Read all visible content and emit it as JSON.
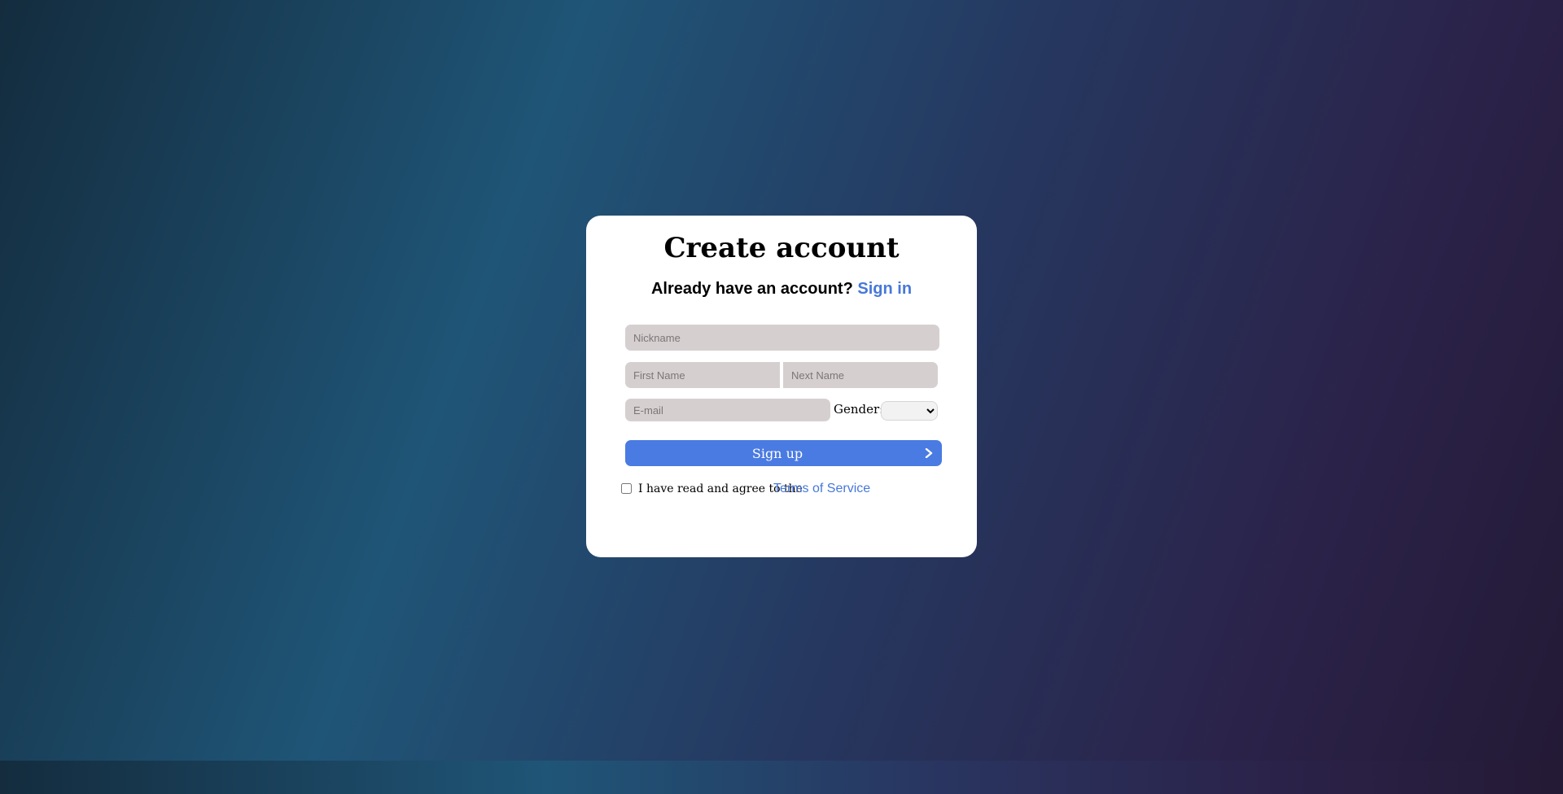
{
  "colors": {
    "accent": "#4a7be2",
    "link": "#4778d9",
    "field_bg": "#d6cfd0",
    "card_bg": "#ffffff"
  },
  "card": {
    "title": "Create account",
    "subtitle_text": "Already have an account?",
    "signin_link": "Sign in"
  },
  "form": {
    "nickname_placeholder": "Nickname",
    "firstname_placeholder": "First Name",
    "nextname_placeholder": "Next Name",
    "email_placeholder": "E-mail",
    "gender_label": "Gender:",
    "gender_selected": "",
    "signup_label": "Sign up",
    "signup_icon": "chevron-right-icon",
    "terms_text": "I have read and agree to the",
    "terms_link": "Terms of Service",
    "terms_checked": false
  }
}
